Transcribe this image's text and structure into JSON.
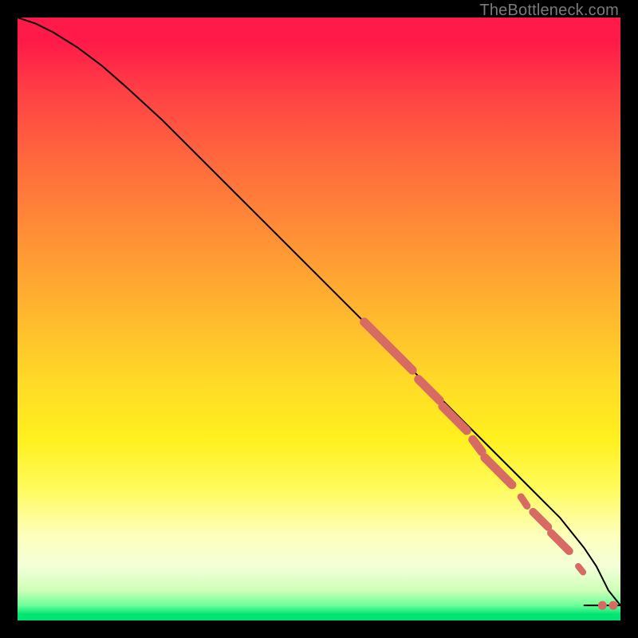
{
  "watermark": "TheBottleneck.com",
  "chart_data": {
    "type": "line",
    "title": "",
    "xlabel": "",
    "ylabel": "",
    "xlim": [
      0,
      100
    ],
    "ylim": [
      0,
      100
    ],
    "grid": false,
    "legend": false,
    "background": "vertical-gradient-red-to-green",
    "series": [
      {
        "name": "curve",
        "stroke": "#000000",
        "x": [
          0,
          3,
          6,
          10,
          14,
          18,
          24,
          30,
          36,
          42,
          48,
          54,
          60,
          66,
          72,
          78,
          84,
          90,
          94,
          96,
          98,
          100
        ],
        "y": [
          100,
          99,
          97.5,
          95,
          92,
          88.5,
          83,
          77,
          71,
          65,
          59,
          53,
          47,
          41,
          35,
          29,
          23,
          17,
          12,
          9,
          5,
          2.5
        ]
      },
      {
        "name": "tail-flat",
        "stroke": "#000000",
        "x": [
          94,
          100
        ],
        "y": [
          2.5,
          2.5
        ]
      }
    ],
    "markers": [
      {
        "name": "highlight-segments",
        "color": "#d76a63",
        "shape": "capsule",
        "items": [
          {
            "x1": 57.5,
            "y1": 49.5,
            "x2": 65.5,
            "y2": 41.5,
            "w": 11
          },
          {
            "x1": 66.5,
            "y1": 40.0,
            "x2": 70.0,
            "y2": 36.5,
            "w": 11
          },
          {
            "x1": 70.5,
            "y1": 35.5,
            "x2": 74.5,
            "y2": 31.5,
            "w": 11
          },
          {
            "x1": 75.5,
            "y1": 30.0,
            "x2": 77.0,
            "y2": 28.0,
            "w": 11
          },
          {
            "x1": 77.5,
            "y1": 27.0,
            "x2": 82.0,
            "y2": 22.5,
            "w": 11
          },
          {
            "x1": 83.5,
            "y1": 20.5,
            "x2": 84.5,
            "y2": 19.0,
            "w": 9
          },
          {
            "x1": 85.5,
            "y1": 18.0,
            "x2": 88.0,
            "y2": 15.5,
            "w": 10
          },
          {
            "x1": 88.5,
            "y1": 14.5,
            "x2": 91.5,
            "y2": 11.5,
            "w": 10
          },
          {
            "x1": 93.0,
            "y1": 9.0,
            "x2": 93.8,
            "y2": 8.0,
            "w": 8
          }
        ]
      },
      {
        "name": "tail-dots",
        "color": "#d76a63",
        "shape": "circle",
        "items": [
          {
            "x": 97.0,
            "y": 2.5,
            "r": 5.5
          },
          {
            "x": 98.8,
            "y": 2.5,
            "r": 5.5
          }
        ]
      }
    ]
  }
}
